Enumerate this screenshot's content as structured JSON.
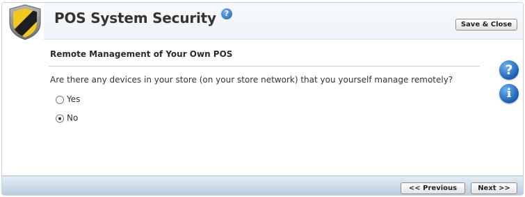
{
  "header": {
    "title": "POS System Security",
    "title_help_glyph": "?",
    "save_close_label": "Save & Close",
    "shield_icon": "shield-icon"
  },
  "section": {
    "title": "Remote Management of Your Own POS",
    "question": "Are there any devices in your store (on your store network) that you yourself manage remotely?",
    "options": [
      {
        "label": "Yes",
        "selected": false
      },
      {
        "label": "No",
        "selected": true
      }
    ]
  },
  "side_icons": {
    "help_glyph": "?",
    "info_glyph": "i"
  },
  "footer": {
    "previous_label": "<< Previous",
    "next_label": "Next >>"
  },
  "colors": {
    "accent_blue": "#1d66b8",
    "shield_yellow": "#f2c81f",
    "footer_blue": "#b8cde0"
  }
}
